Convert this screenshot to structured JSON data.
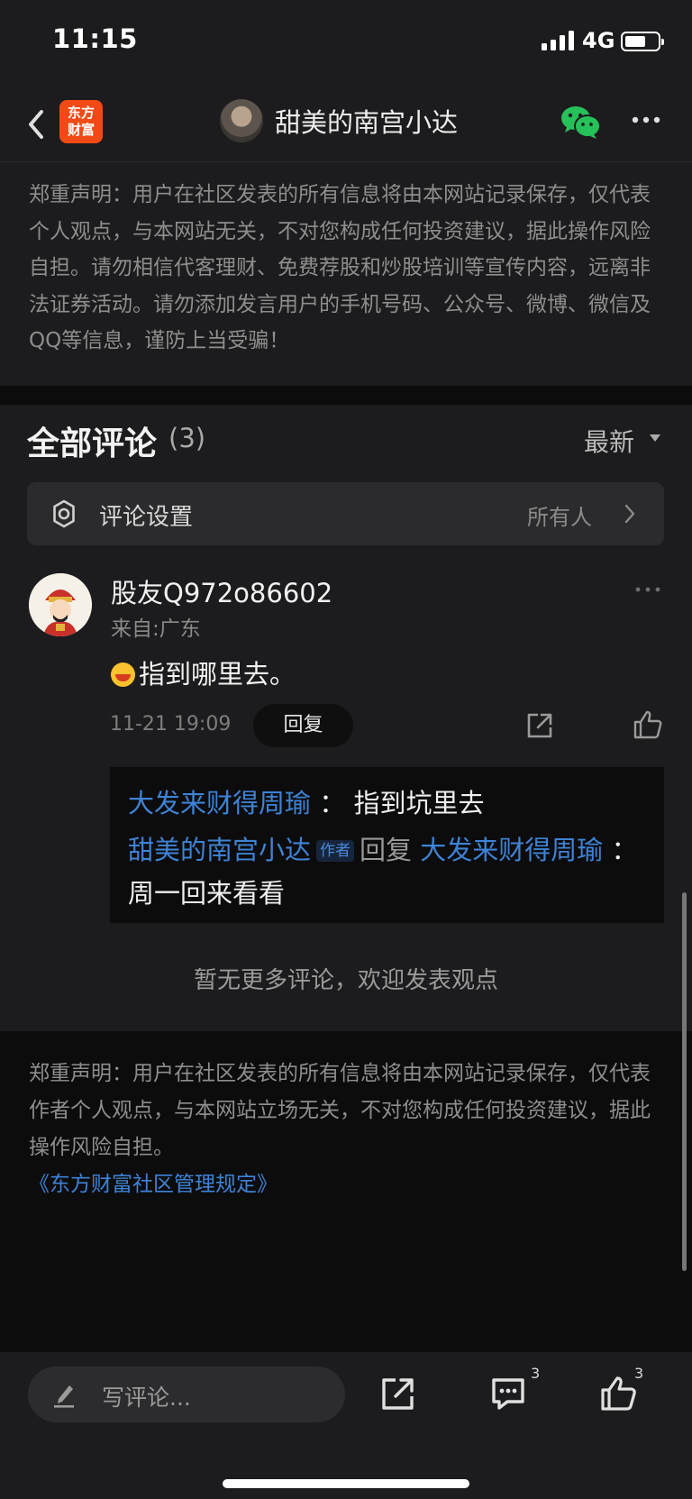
{
  "status_bar": {
    "time": "11:15",
    "network": "4G"
  },
  "header": {
    "logo_text": "东方财富",
    "title": "甜美的南宫小达"
  },
  "disclaimer_top": "郑重声明：用户在社区发表的所有信息将由本网站记录保存，仅代表个人观点，与本网站无关，不对您构成任何投资建议，据此操作风险自担。请勿相信代客理财、免费荐股和炒股培训等宣传内容，远离非法证券活动。请勿添加发言用户的手机号码、公众号、微博、微信及QQ等信息，谨防上当受骗！",
  "comments": {
    "title": "全部评论",
    "count": "(3)",
    "sort_label": "最新",
    "settings": {
      "label": "评论设置",
      "value": "所有人"
    },
    "items": [
      {
        "user": "股友Q972o86602",
        "location": "来自:广东",
        "text": "指到哪里去。",
        "time": "11-21 19:09",
        "reply_label": "回复",
        "replies": [
          {
            "from": "大发来财得周瑜",
            "sep": "：",
            "text": "指到坑里去"
          },
          {
            "from": "甜美的南宫小达",
            "tag": "作者",
            "verb": "回复",
            "to": "大发来财得周瑜",
            "sep": "：",
            "text": "周一回来看看"
          }
        ]
      }
    ],
    "no_more": "暂无更多评论，欢迎发表观点"
  },
  "footer": {
    "disclaimer": "郑重声明：用户在社区发表的所有信息将由本网站记录保存，仅代表作者个人观点，与本网站立场无关，不对您构成任何投资建议，据此操作风险自担。",
    "rules_link": "《东方财富社区管理规定》"
  },
  "bottom_bar": {
    "input_placeholder": "写评论...",
    "comment_count": "3",
    "like_count": "3"
  },
  "icons": {
    "back": "chevron-left-icon",
    "wechat": "wechat-icon",
    "more": "more-horizontal-icon",
    "settings": "gear-icon",
    "share": "share-icon",
    "comment": "comment-icon",
    "like": "thumbs-up-icon",
    "edit": "pen-icon"
  },
  "colors": {
    "link": "#3e83d6",
    "logo": "#f24a15",
    "wechat": "#27c15a",
    "background": "#1c1c1e"
  }
}
